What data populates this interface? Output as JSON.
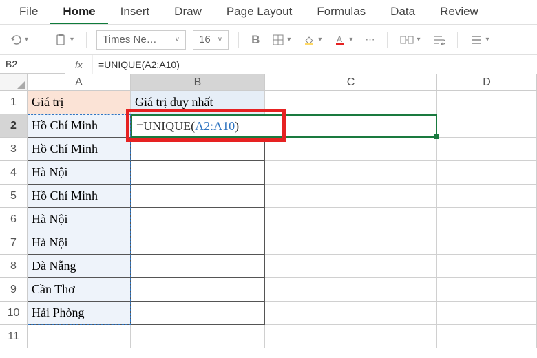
{
  "ribbon": {
    "tabs": [
      "File",
      "Home",
      "Insert",
      "Draw",
      "Page Layout",
      "Formulas",
      "Data",
      "Review"
    ],
    "active_tab": "Home"
  },
  "toolbar": {
    "font_name": "Times Ne…",
    "font_size": "16",
    "bold_label": "B"
  },
  "formula_bar": {
    "name_box": "B2",
    "fx": "fx",
    "formula_text": "=UNIQUE(A2:A10)"
  },
  "columns": [
    "A",
    "B",
    "C",
    "D"
  ],
  "row_numbers": [
    1,
    2,
    3,
    4,
    5,
    6,
    7,
    8,
    9,
    10,
    11
  ],
  "headers": {
    "a1": "Giá trị",
    "b1": "Giá trị duy nhất"
  },
  "column_a": [
    "Hồ Chí Minh",
    "Hồ Chí Minh",
    "Hà Nội",
    "Hồ Chí Minh",
    "Hà Nội",
    "Hà Nội",
    "Đà Nẵng",
    "Cần Thơ",
    "Hải Phòng"
  ],
  "editing_cell": {
    "prefix": "=UNIQUE(",
    "ref": "A2:A10",
    "suffix": ")"
  },
  "icons": {
    "undo": "undo-icon",
    "clipboard": "clipboard-icon",
    "border": "border-icon",
    "fill": "fill-icon",
    "font_color": "font-color-icon",
    "merge": "merge-icon",
    "wrap": "wrap-icon",
    "align": "align-icon"
  },
  "colors": {
    "selection_border": "#1a7a3f",
    "highlight_border": "#e62222",
    "reference": "#2f74c0",
    "header_a_bg": "#fbe3d6",
    "header_b_bg": "#e6eef7"
  }
}
